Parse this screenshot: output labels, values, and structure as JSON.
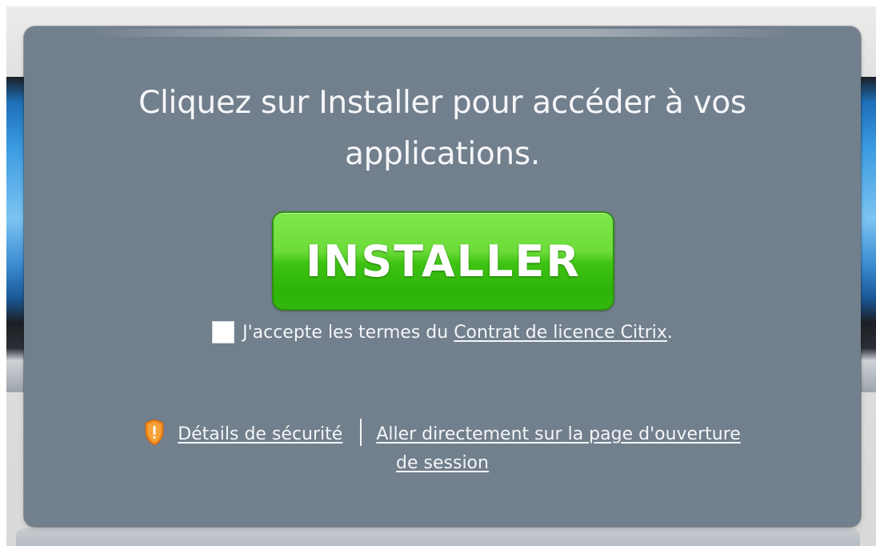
{
  "dialog": {
    "headline": "Cliquez sur Installer pour accéder à vos applications.",
    "install_button_label": "INSTALLER",
    "license": {
      "checked": false,
      "prefix": "J'accepte les termes du ",
      "link_text": "Contrat de licence Citrix",
      "suffix": "."
    },
    "security_link": "Détails de sécurité",
    "security_icon": "shield-warning-icon",
    "logon_link": "Aller directement sur la page d'ouverture de session"
  },
  "colors": {
    "dialog_bg": "#727f8d",
    "button_green": "#3fc414",
    "shield_orange": "#f08a1c"
  }
}
